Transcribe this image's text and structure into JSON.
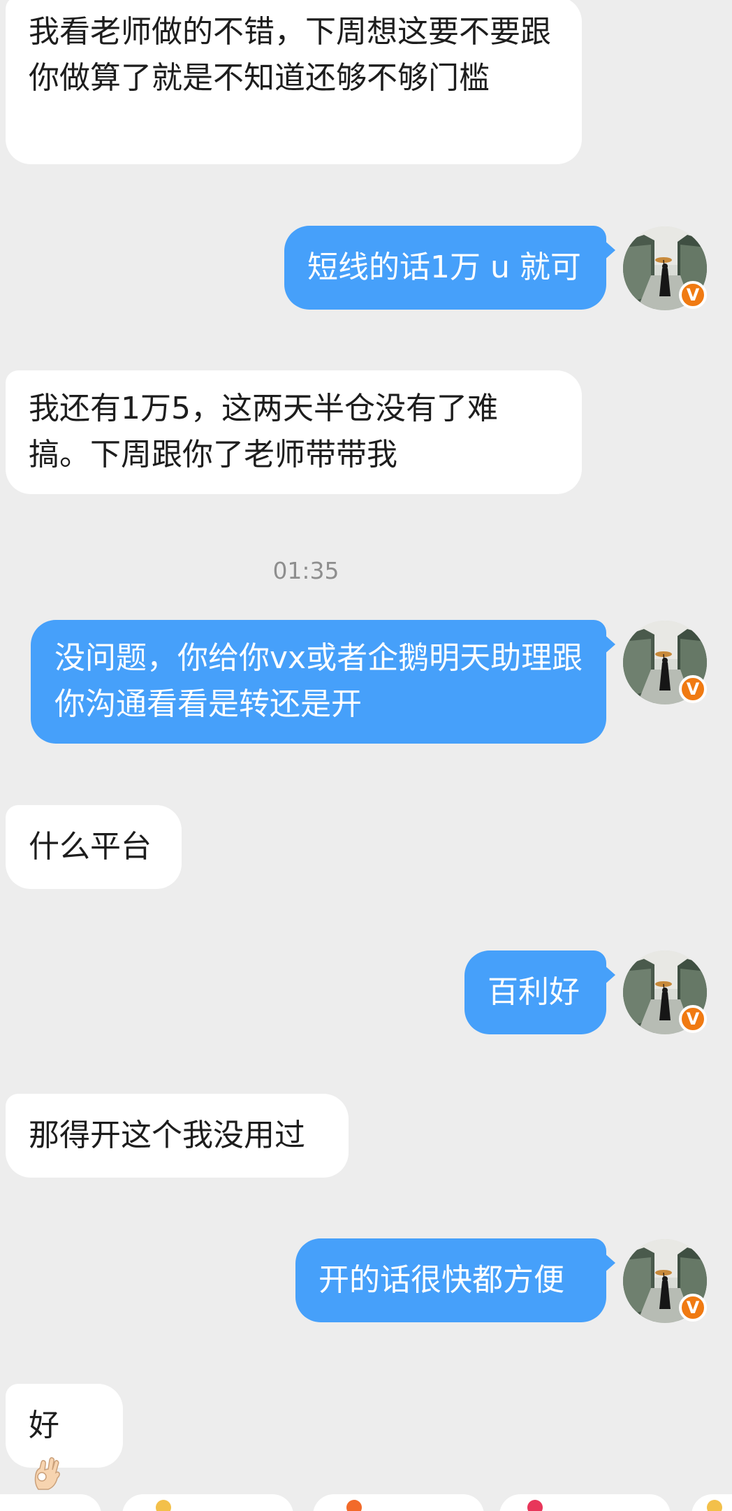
{
  "messages": [
    {
      "side": "in",
      "text": "我看老师做的不错，下周想这要不要跟你做算了就是不知道还够不够门槛"
    },
    {
      "side": "out",
      "text": "短线的话1万 u 就可"
    },
    {
      "side": "in",
      "text": "我还有1万5，这两天半仓没有了难搞。下周跟你了老师带带我"
    },
    {
      "side": "time",
      "text": "01:35"
    },
    {
      "side": "out",
      "text": "没问题，你给你vx或者企鹅明天助理跟你沟通看看是转还是开"
    },
    {
      "side": "in",
      "text": "什么平台"
    },
    {
      "side": "out",
      "text": "百利好"
    },
    {
      "side": "in",
      "text": "那得开这个我没用过"
    },
    {
      "side": "out",
      "text": "开的话很快都方便"
    },
    {
      "side": "in",
      "text": "好",
      "emoji": "ok-hand-emoji"
    }
  ],
  "avatar": {
    "badge": "V",
    "badge_color": "#f07a12"
  },
  "colors": {
    "background": "#ededed",
    "incoming": "#ffffff",
    "outgoing": "#46a0fa"
  }
}
